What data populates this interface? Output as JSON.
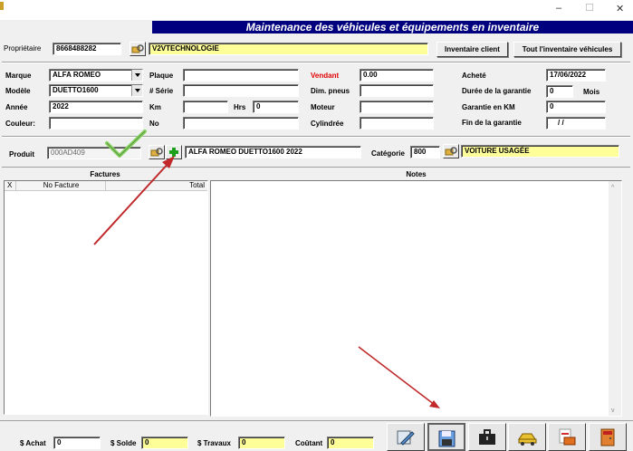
{
  "window": {
    "minimize": "–",
    "maximize": "☐",
    "close": "✕"
  },
  "title": "Maintenance des véhicules et équipements en inventaire",
  "owner": {
    "label": "Propriétaire",
    "id": "8668488282",
    "name": "V2VTECHNOLOGIE",
    "btn_client": "Inventaire client",
    "btn_all": "Tout l'inventaire véhicules"
  },
  "vehicle": {
    "marque_label": "Marque",
    "marque": "ALFA ROMEO",
    "modele_label": "Modèle",
    "modele": "DUETTO1600",
    "annee_label": "Année",
    "annee": "2022",
    "couleur_label": "Couleur:",
    "couleur": "",
    "plaque_label": "Plaque",
    "plaque": "",
    "serie_label": "# Série",
    "serie": "",
    "km_label": "Km",
    "km": "",
    "hrs_label": "Hrs",
    "hrs": "0",
    "no_label": "No",
    "no": "",
    "vendant_label": "Vendant",
    "vendant": "0.00",
    "pneus_label": "Dim. pneus",
    "pneus": "",
    "moteur_label": "Moteur",
    "moteur": "",
    "cyl_label": "Cylindrée",
    "cyl": "",
    "achete_label": "Acheté",
    "achete": "17/06/2022",
    "duree_label": "Durée de la garantie",
    "duree": "0",
    "mois_label": "Mois",
    "gkm_label": "Garantie en KM",
    "gkm": "0",
    "fin_label": "Fin de la garantie",
    "fin": "/ /"
  },
  "product": {
    "label": "Produit",
    "code": "000AD409",
    "desc": "ALFA ROMEO DUETTO1600 2022",
    "cat_label": "Catégorie",
    "cat_code": "800",
    "cat_name": "VOITURE USAGÉE"
  },
  "factures": {
    "header": "Factures",
    "col_x": "X",
    "col_no": "No Facture",
    "col_total": "Total"
  },
  "notes": {
    "header": "Notes"
  },
  "totals": {
    "achat_label": "$ Achat",
    "achat": "0",
    "solde_label": "$ Solde",
    "solde": "0",
    "travaux_label": "$ Travaux",
    "travaux": "0",
    "coutant_label": "Coûtant",
    "coutant": "0"
  },
  "colors": {
    "title_bg": "#00007f",
    "highlight": "#ffff99",
    "vendant": "#ff0000",
    "arrow": "#c0282a",
    "check": "#7ec850"
  }
}
